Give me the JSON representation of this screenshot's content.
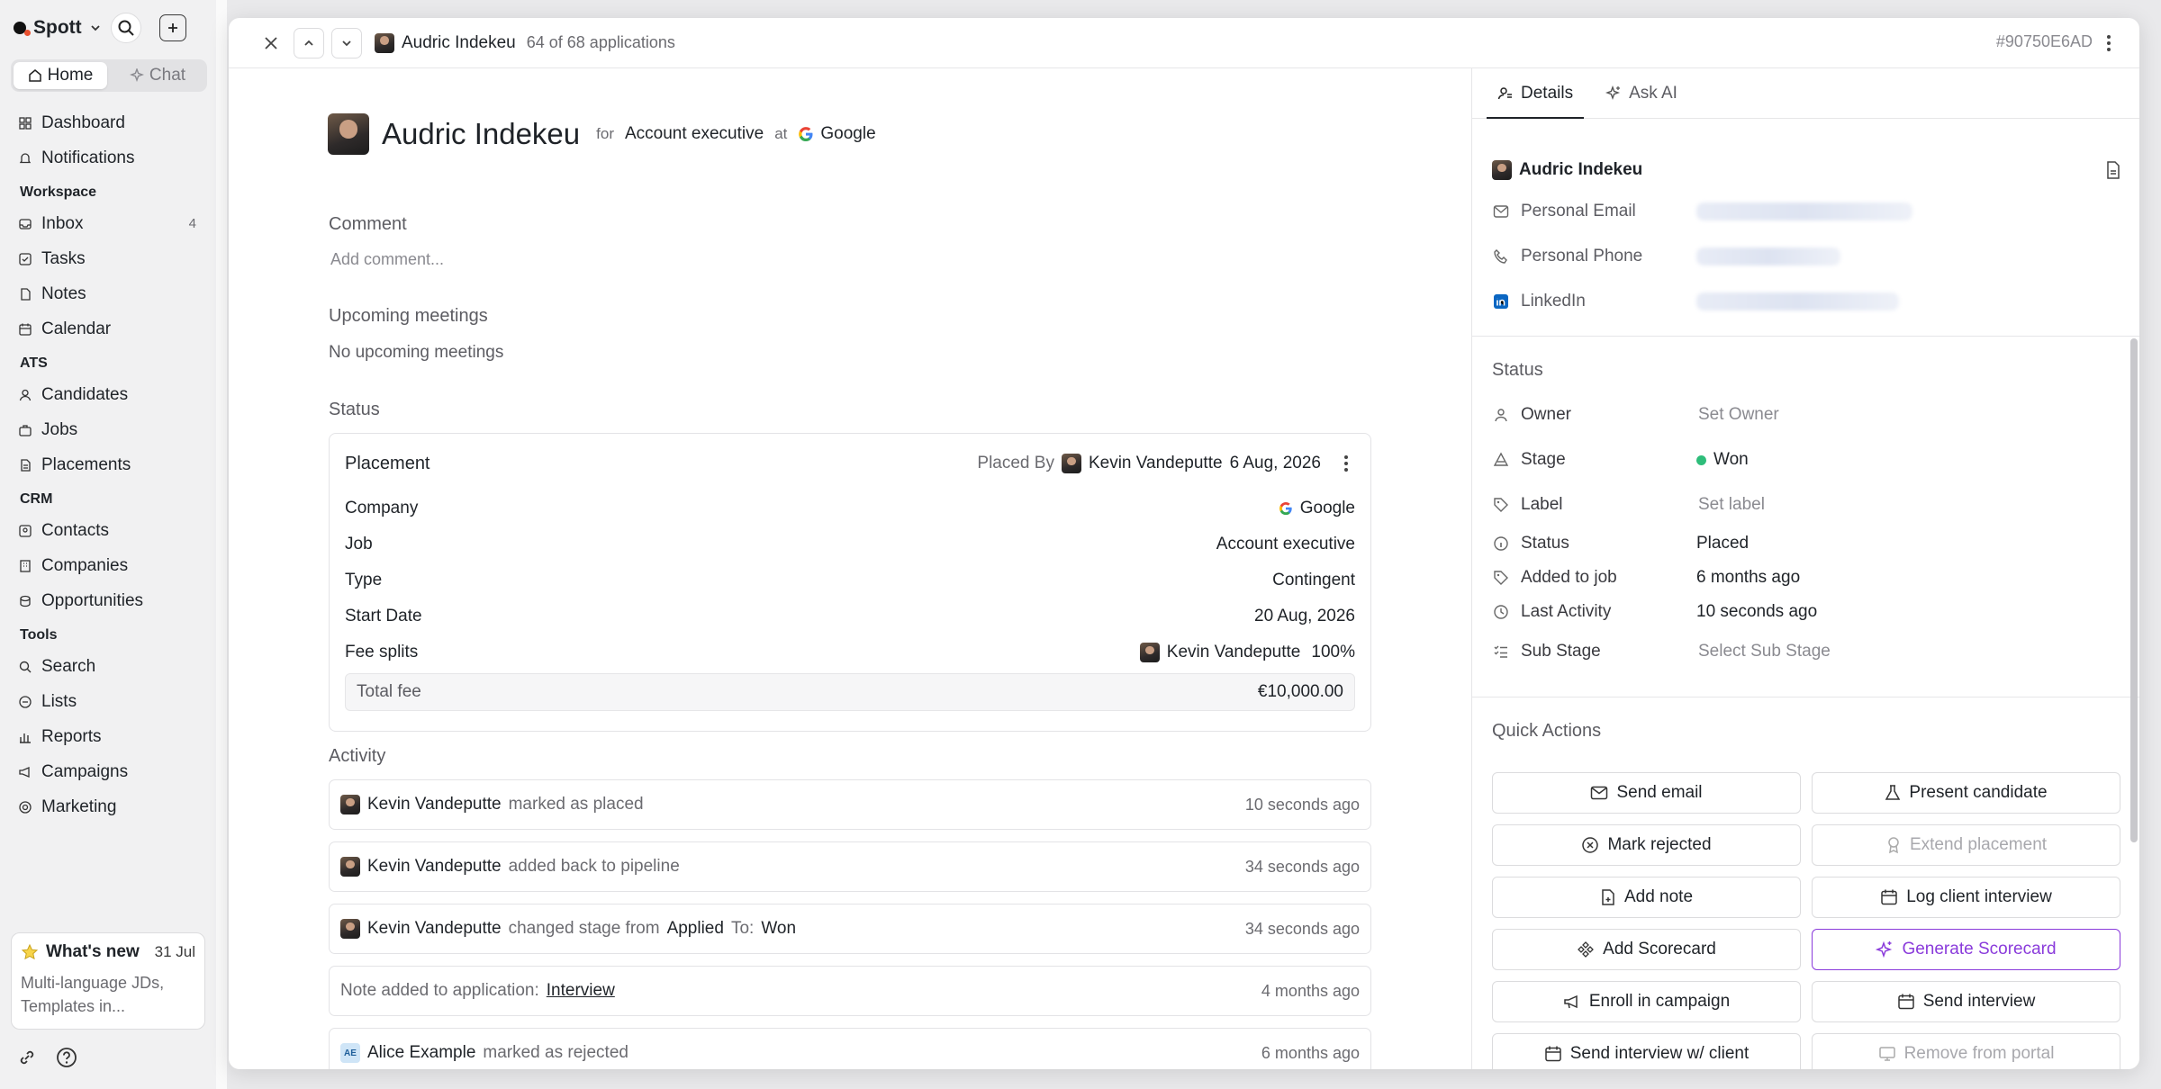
{
  "sidebar": {
    "brand": "Spott",
    "tabs": [
      "Home",
      "Chat"
    ],
    "items": {
      "dashboard": "Dashboard",
      "notifications": "Notifications",
      "workspace": "Workspace",
      "inbox": "Inbox",
      "inbox_count": "4",
      "tasks": "Tasks",
      "notes": "Notes",
      "calendar": "Calendar",
      "ats": "ATS",
      "candidates": "Candidates",
      "jobs": "Jobs",
      "placements": "Placements",
      "crm": "CRM",
      "contacts": "Contacts",
      "companies": "Companies",
      "opportunities": "Opportunities",
      "tools": "Tools",
      "search": "Search",
      "lists": "Lists",
      "reports": "Reports",
      "campaigns": "Campaigns",
      "marketing": "Marketing"
    },
    "whats_new": {
      "title": "What's new",
      "date": "31 Jul",
      "line1": "Multi-language JDs,",
      "line2": "Templates in..."
    }
  },
  "topbar": {
    "name": "Audric Indekeu",
    "count": "64 of 68 applications",
    "id": "#90750E6AD"
  },
  "main": {
    "name": "Audric Indekeu",
    "for": "for",
    "role": "Account executive",
    "at": "at",
    "company": "Google",
    "comment_title": "Comment",
    "comment_placeholder": "Add comment...",
    "meetings_title": "Upcoming meetings",
    "meetings_empty": "No upcoming meetings",
    "status_title": "Status",
    "placement": {
      "title": "Placement",
      "placed_by": "Placed By",
      "placed_by_name": "Kevin Vandeputte",
      "placed_date": "6 Aug, 2026",
      "company_label": "Company",
      "company_value": "Google",
      "job_label": "Job",
      "job_value": "Account executive",
      "type_label": "Type",
      "type_value": "Contingent",
      "start_label": "Start Date",
      "start_value": "20 Aug, 2026",
      "fee_label": "Fee splits",
      "fee_name": "Kevin Vandeputte",
      "fee_pct": "100%",
      "total_label": "Total fee",
      "total_value": "€10,000.00"
    },
    "activity_title": "Activity",
    "activity": [
      {
        "who": "Kevin Vandeputte",
        "what": "marked as placed",
        "time": "10 seconds ago"
      },
      {
        "who": "Kevin Vandeputte",
        "what": "added back to pipeline",
        "time": "34 seconds ago"
      },
      {
        "who": "Kevin Vandeputte",
        "what": "changed stage from",
        "from": "Applied",
        "to_label": "To:",
        "to": "Won",
        "time": "34 seconds ago"
      },
      {
        "what": "Note added to application:",
        "link": "Interview",
        "time": "4 months ago"
      },
      {
        "initials": "AE",
        "who": "Alice Example",
        "what": "marked as rejected",
        "time": "6 months ago"
      }
    ]
  },
  "side": {
    "tabs": [
      "Details",
      "Ask AI"
    ],
    "person": "Audric Indekeu",
    "contact": {
      "email": "Personal Email",
      "phone": "Personal Phone",
      "linkedin": "LinkedIn"
    },
    "status_title": "Status",
    "fields": {
      "owner": "Owner",
      "owner_val": "Set Owner",
      "stage": "Stage",
      "stage_val": "Won",
      "label": "Label",
      "label_val": "Set label",
      "status": "Status",
      "status_val": "Placed",
      "added": "Added to job",
      "added_val": "6 months ago",
      "activity": "Last Activity",
      "activity_val": "10 seconds ago",
      "substage": "Sub Stage",
      "substage_val": "Select Sub Stage"
    },
    "quick_title": "Quick Actions",
    "quick": {
      "send_email": "Send email",
      "present": "Present candidate",
      "reject": "Mark rejected",
      "extend": "Extend placement",
      "note": "Add note",
      "log_interview": "Log client interview",
      "add_scorecard": "Add Scorecard",
      "gen_scorecard": "Generate Scorecard",
      "enroll": "Enroll in campaign",
      "send_interview": "Send interview",
      "send_interview_client": "Send interview w/ client",
      "remove_portal": "Remove from portal"
    }
  },
  "colors": {
    "accent": "#8a3bdb",
    "won": "#2ebd7a",
    "brand": "#e8502f"
  }
}
